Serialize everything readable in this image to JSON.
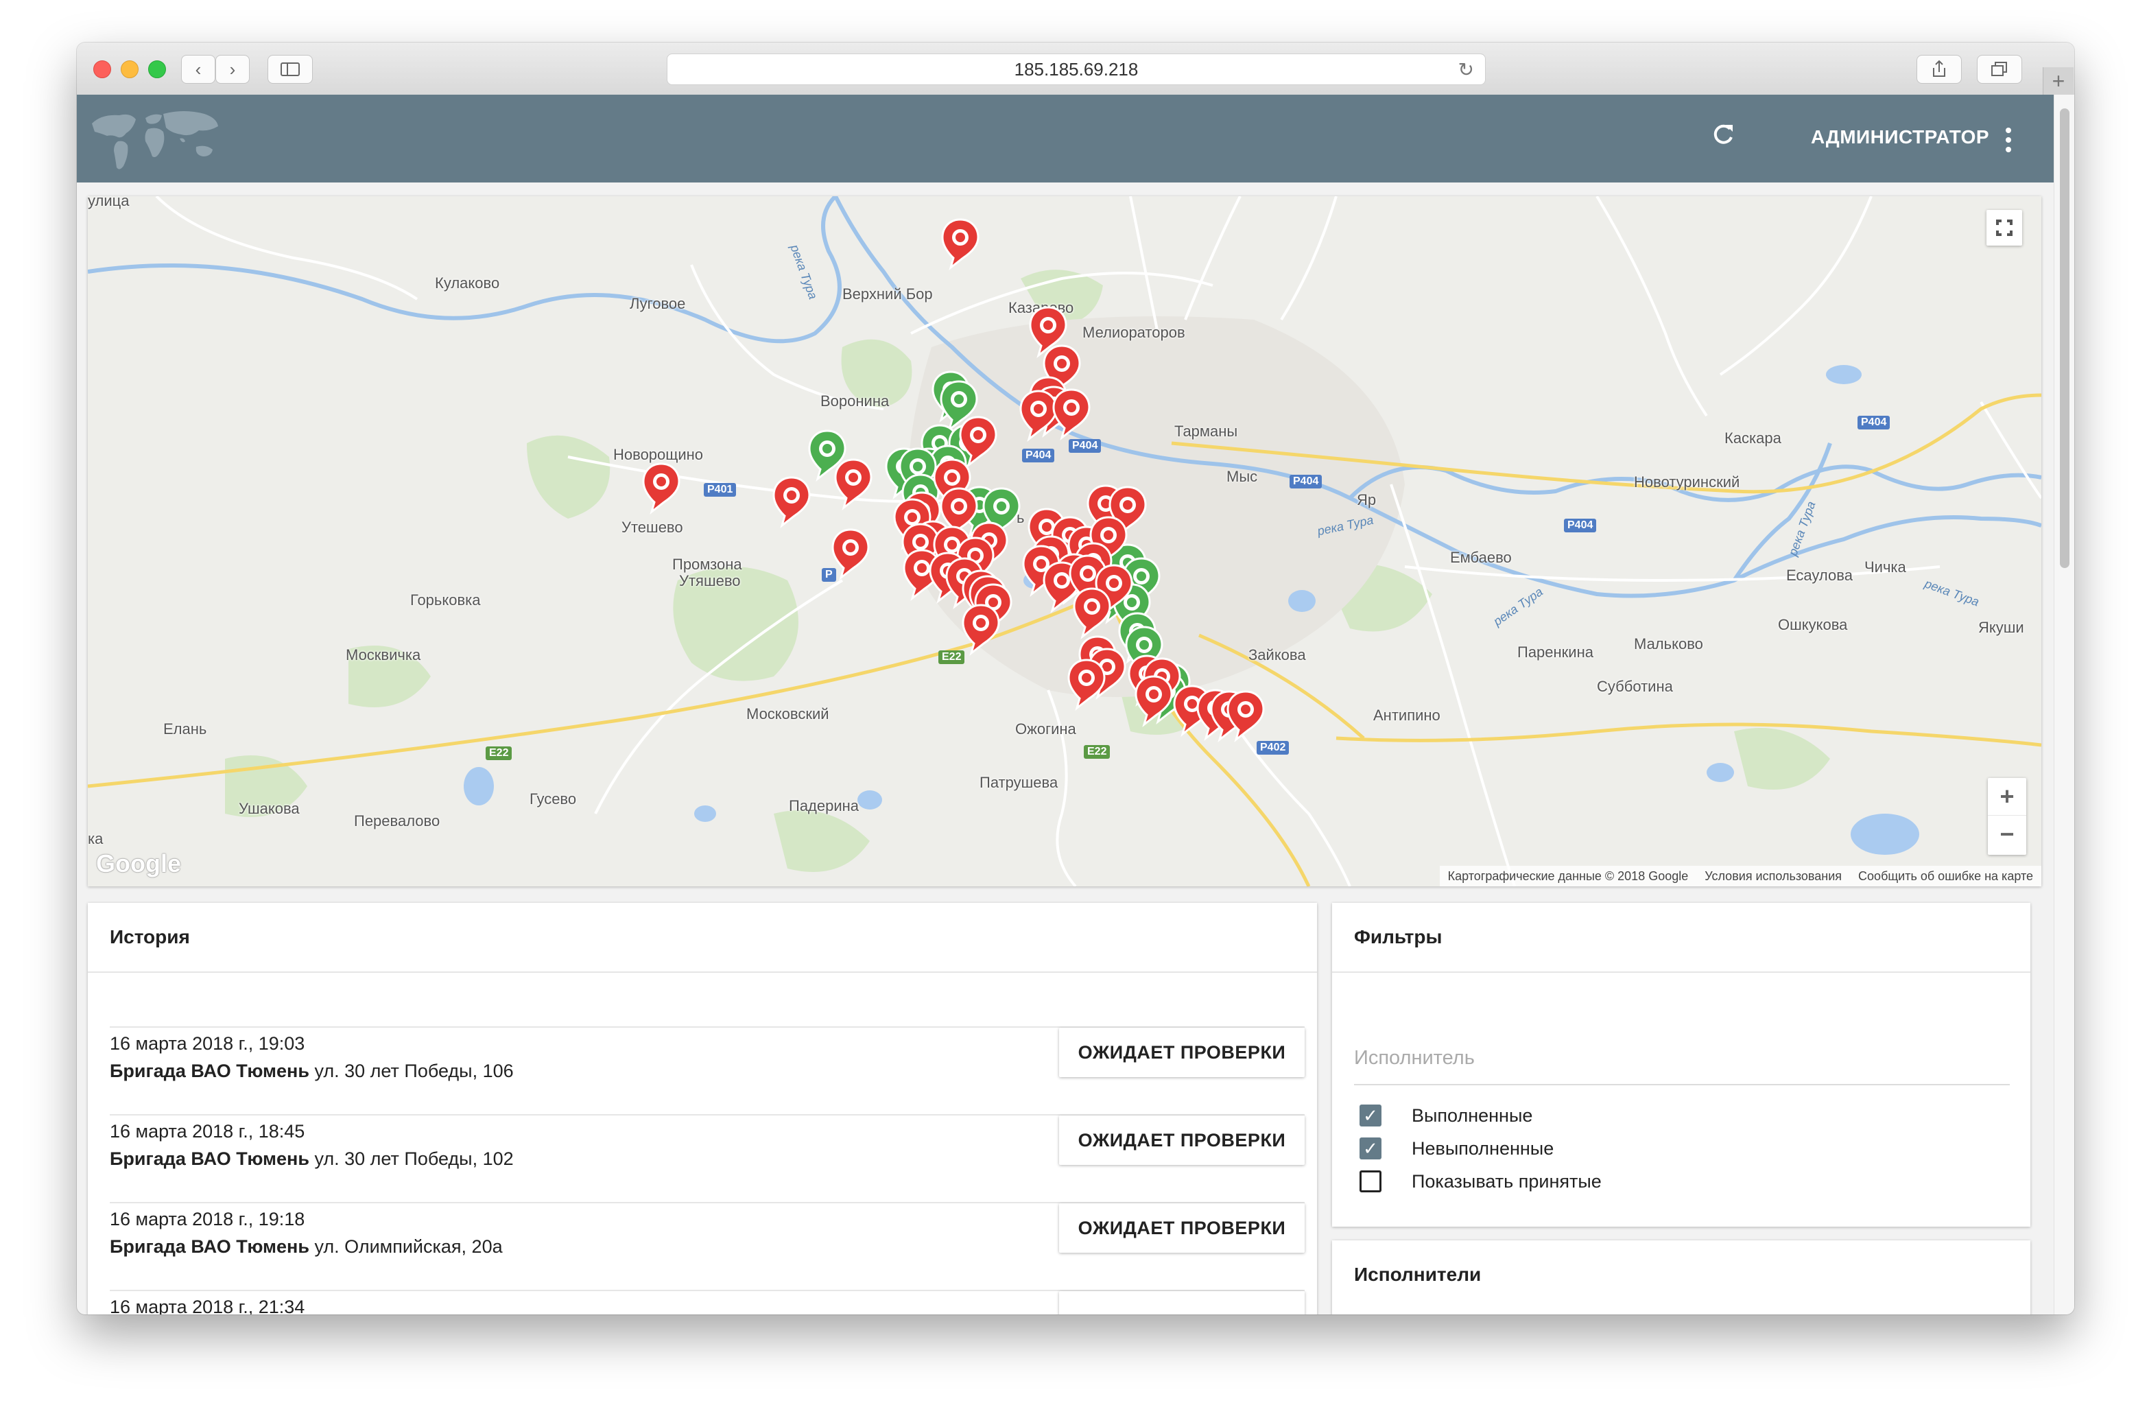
{
  "browser": {
    "url": "185.185.69.218"
  },
  "header": {
    "user_label": "АДМИНИСТРАТОР"
  },
  "map": {
    "places": [
      "улица",
      "Кулаково",
      "Луговое",
      "Верхний Бор",
      "Казарово",
      "Мелиораторов",
      "Воронина",
      "Новорощино",
      "Тарманы",
      "Мыс",
      "Каскара",
      "Новотуринский",
      "Утешево",
      "Яр",
      "Промзона",
      "Утяшево",
      "Горьковка",
      "Ембаево",
      "Есаулова",
      "Чичка",
      "Москвичка",
      "Ошкукова",
      "Якуши",
      "Паренкина",
      "Мальково",
      "Зайкова",
      "Субботина",
      "Московский",
      "Елань",
      "Антипино",
      "Ожогина",
      "Ушакова",
      "Гусево",
      "Перевалово",
      "Падерина",
      "Патрушева",
      "ка",
      "ь"
    ],
    "rivers": [
      "река Тура",
      "река Тура",
      "река Тура",
      "река Тура",
      "река Тура"
    ],
    "roads": [
      "Р401",
      "Р404",
      "Р404",
      "Р404",
      "Р404",
      "Р404",
      "E22",
      "E22",
      "E22",
      "Р402",
      "Р"
    ],
    "markers_red": 49,
    "markers_green": 14,
    "zoom_in": "+",
    "zoom_out": "−",
    "google": "Google",
    "attribution": {
      "data": "Картографические данные © 2018 Google",
      "terms": "Условия использования",
      "report": "Сообщить об ошибке на карте"
    },
    "colors": {
      "red_marker": "#e53935",
      "green_marker": "#4caf50"
    }
  },
  "history": {
    "title": "История",
    "items": [
      {
        "date": "16 марта 2018 г., 19:03",
        "team": "Бригада ВАО Тюмень",
        "address": "ул. 30 лет Победы, 106",
        "status": "ОЖИДАЕТ ПРОВЕРКИ"
      },
      {
        "date": "16 марта 2018 г., 18:45",
        "team": "Бригада ВАО Тюмень",
        "address": "ул. 30 лет Победы, 102",
        "status": "ОЖИДАЕТ ПРОВЕРКИ"
      },
      {
        "date": "16 марта 2018 г., 19:18",
        "team": "Бригада ВАО Тюмень",
        "address": "ул. Олимпийская, 20а",
        "status": "ОЖИДАЕТ ПРОВЕРКИ"
      },
      {
        "date": "16 марта 2018 г., 21:34"
      }
    ]
  },
  "filters": {
    "title": "Фильтры",
    "executor_placeholder": "Исполнитель",
    "options": [
      {
        "label": "Выполненные",
        "checked": true
      },
      {
        "label": "Невыполненные",
        "checked": true
      },
      {
        "label": "Показывать принятые",
        "checked": false
      }
    ]
  },
  "executors": {
    "title": "Исполнители"
  }
}
